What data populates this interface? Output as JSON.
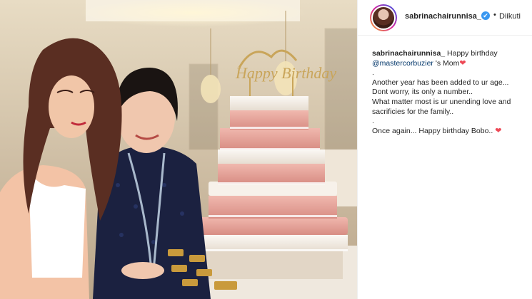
{
  "post": {
    "username": "sabrinachairunnisa_",
    "verified_badge": "✔",
    "separator": "•",
    "follow_label": "Diikuti"
  },
  "caption": {
    "username": "sabrinachairunnisa_",
    "line1_text": "Happy birthday",
    "mention": "@mastercorbuzier",
    "line1_suffix": "'s Mom",
    "heart": "❤",
    "dot1": ".",
    "para1_line1": "Another year has been added to ur age...",
    "para1_line2": "Dont worry, its only a number..",
    "para1_line3": "What matter most is ur unending love and sacrificies for the family..",
    "dot2": ".",
    "closing": "Once again... Happy birthday Bobo..",
    "heart2": "❤"
  },
  "photo": {
    "cake_topper_text": "Happy Birthday",
    "icons": {
      "verified": "verified-icon",
      "heart": "heart-icon"
    },
    "colors": {
      "cake_pink": "#e9a7a0",
      "cake_white": "#f4efe9",
      "dress_navy": "#1b2140",
      "bg_warm": "#d9cbb4"
    }
  }
}
